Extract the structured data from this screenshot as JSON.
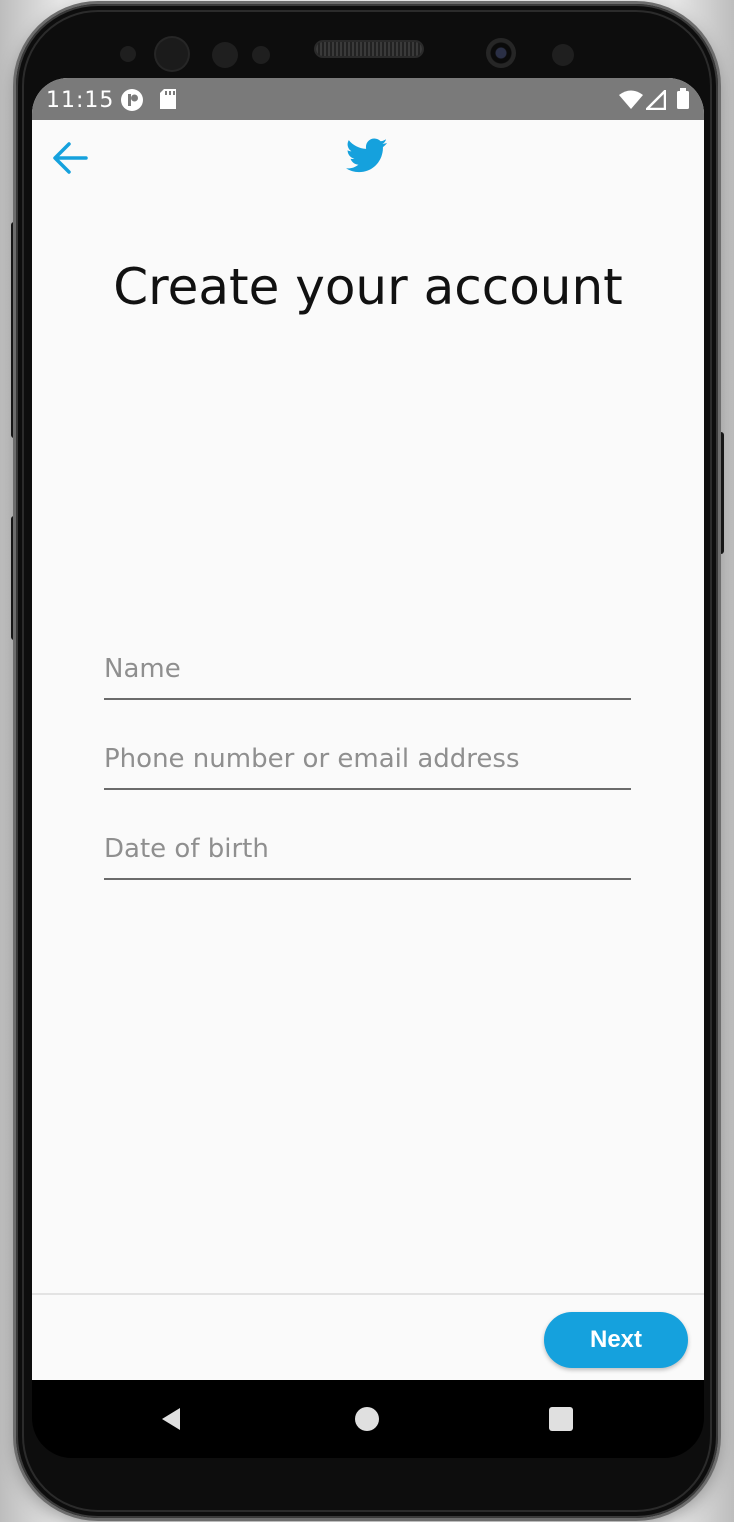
{
  "status_bar": {
    "time": "11:15"
  },
  "toolbar": {
    "back_icon": "arrow-left-icon",
    "logo_icon": "twitter-bird-icon"
  },
  "main": {
    "title": "Create your account",
    "fields": [
      {
        "placeholder": "Name",
        "value": ""
      },
      {
        "placeholder": "Phone number or email address",
        "value": ""
      },
      {
        "placeholder": "Date of birth",
        "value": ""
      }
    ]
  },
  "footer": {
    "next_label": "Next"
  },
  "nav_bar": {
    "back_icon": "triangle-back-icon",
    "home_icon": "circle-home-icon",
    "recents_icon": "square-recents-icon"
  },
  "colors": {
    "brand_blue": "#15a1dd",
    "status_bar": "#7a7a7a",
    "screen_bg": "#fafafa"
  }
}
